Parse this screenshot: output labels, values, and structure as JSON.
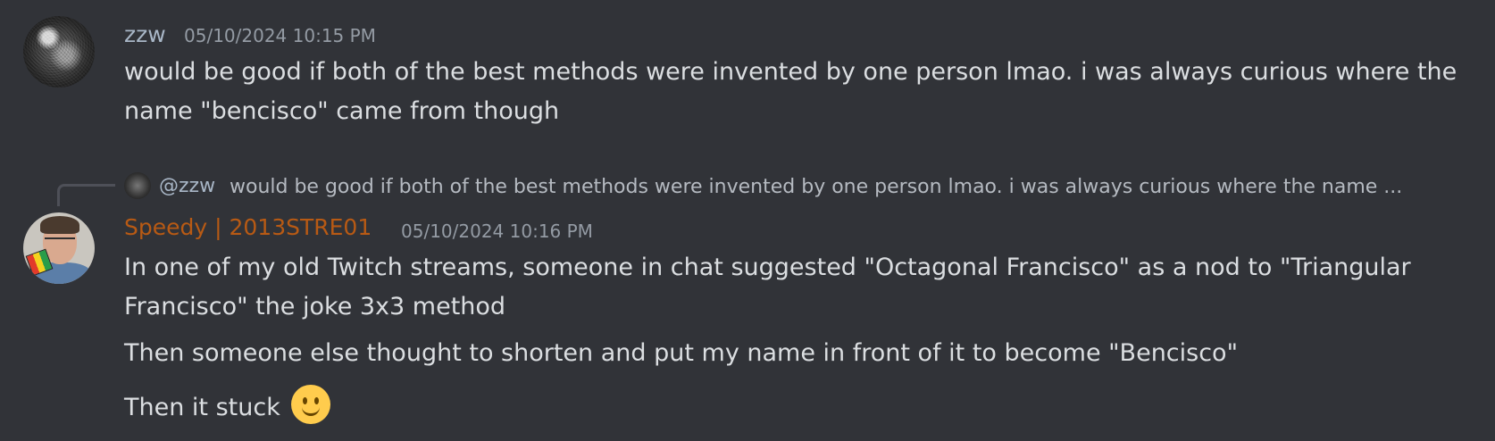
{
  "messages": [
    {
      "author": "zzw",
      "timestamp": "05/10/2024 10:15 PM",
      "lines": [
        "would be good if both of the best methods were invented by one person lmao. i was always curious where the",
        "name \"bencisco\" came from though"
      ],
      "avatar_icon": "zzw-avatar"
    },
    {
      "reply_to": {
        "author": "@zzw",
        "text": "would be good if both of the best methods were invented by one person lmao. i was always curious where the name ..."
      },
      "author": "Speedy | 2013STRE01",
      "author_color": "#b85a14",
      "timestamp": "05/10/2024 10:16 PM",
      "lines": [
        "In one of my old Twitch streams, someone in chat suggested \"Octagonal Francisco\" as a nod to \"Triangular",
        "Francisco\" the joke 3x3 method",
        "Then someone else thought to shorten and put my name in front of it to become \"Bencisco\"",
        "Then it stuck"
      ],
      "emoji": "slightly-smiling-face-icon",
      "avatar_icon": "speedy-avatar"
    }
  ],
  "colors": {
    "background": "#313338",
    "text": "#dbdee1",
    "muted": "#949ba4",
    "zzw_name": "#a8b6c6"
  }
}
